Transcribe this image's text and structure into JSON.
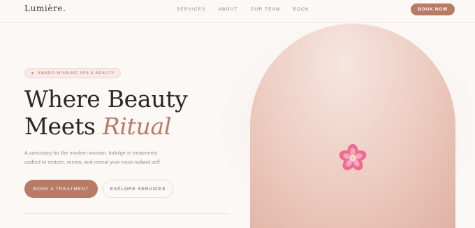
{
  "header": {
    "logo": "Lumière.",
    "nav": [
      "SERVICES",
      "ABOUT",
      "OUR TEAM",
      "BOOK"
    ],
    "cta": "BOOK NOW"
  },
  "hero": {
    "badge": "AWARD-WINNING SPA & BEAUTY",
    "headline_line1": "Where Beauty",
    "headline_line2": "Meets",
    "headline_accent": "Ritual",
    "description": "A sanctuary for the modern woman. Indulge in treatments crafted to restore, renew, and reveal your most radiant self.",
    "primary_button": "BOOK A TREATMENT",
    "secondary_button": "EXPLORE SERVICES"
  },
  "visual": {
    "icon": "cherry-blossom-icon"
  },
  "colors": {
    "accent": "#b97a66",
    "background": "#fbf8f6",
    "blossom": "#ee6a8f"
  }
}
